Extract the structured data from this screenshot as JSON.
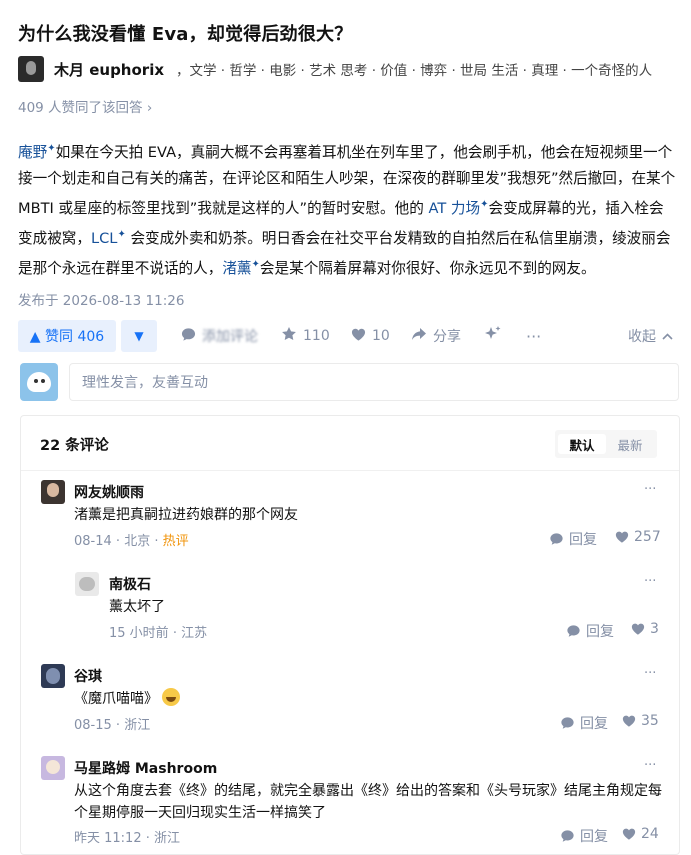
{
  "question": {
    "title": "为什么我没看懂 Eva，却觉得后劲很大？"
  },
  "author": {
    "name": "木月 euphorix",
    "bio": "，文学 · 哲学 · 电影 · 艺术 思考 · 价值 · 博弈 · 世局 生活 · 真理 · 一个奇怪的人"
  },
  "vote_summary": "409 人赞同了该回答 ›",
  "answer": {
    "seg1_link": "庵野",
    "seg2": "如果在今天拍 EVA，真嗣大概不会再塞着耳机坐在列车里了，他会刷手机，他会在短视频里一个接一个划走和自己有关的痛苦，在评论区和陌生人吵架，在深夜的群聊里发”我想死”然后撤回，在某个 MBTI 或星座的标签里找到”我就是这样的人”的暂时安慰。他的 ",
    "seg3_link": "AT 力场",
    "seg4": "会变成屏幕的光，插入栓会变成被窝，",
    "seg5_link": "LCL",
    "seg6": " 会变成外卖和奶茶。明日香会在社交平台发精致的自拍然后在私信里崩溃，绫波丽会是那个永远在群里不说话的人，",
    "seg7_link": "渚薰",
    "seg8": "会是某个隔着屏幕对你很好、你永远见不到的网友。",
    "spark": "✦"
  },
  "publish_time": "发布于 2026-08-13 11:26",
  "actions": {
    "upvote_label": "▲ 赞同 406",
    "downvote_label": "▼",
    "comment_label": "添加评论",
    "favorite_count": "110",
    "like_count": "10",
    "share_label": "分享",
    "collapse_label": "收起",
    "comment_icon": "comment-bubble-icon",
    "star_icon": "star-icon",
    "heart_icon": "heart-icon",
    "share_icon": "share-arrow-icon",
    "ai_icon": "sparkle-icon",
    "more_icon": "ellipsis-icon"
  },
  "comment_input": {
    "placeholder": "理性发言，友善互动"
  },
  "comments_panel": {
    "count_label": "22 条评论",
    "sort_default": "默认",
    "sort_latest": "最新",
    "items": [
      {
        "name": "网友姚顺雨",
        "text": "渚薰是把真嗣拉进药娘群的那个网友",
        "date": "08-14",
        "location": "北京",
        "hot": "热评",
        "reply": "回复",
        "likes": "257",
        "more": "···"
      },
      {
        "name": "南极石",
        "text": "薰太坏了",
        "date": "15 小时前",
        "location": "江苏",
        "reply": "回复",
        "likes": "3",
        "more": "···"
      },
      {
        "name": "谷琪",
        "text": "《魔爪喵喵》",
        "date": "08-15",
        "location": "浙江",
        "reply": "回复",
        "likes": "35",
        "more": "···"
      },
      {
        "name": "马星路姆 Mashroom",
        "text": "从这个角度去套《终》的结尾，就完全暴露出《终》给出的答案和《头号玩家》结尾主角规定每个星期停服一天回归现实生活一样搞笑了",
        "date": "昨天 11:12",
        "location": "浙江",
        "reply": "回复",
        "likes": "24",
        "more": "···"
      }
    ]
  },
  "colors": {
    "accent": "#1772f6",
    "link": "#175199",
    "muted": "#8590a6",
    "hot": "#f1940b"
  }
}
